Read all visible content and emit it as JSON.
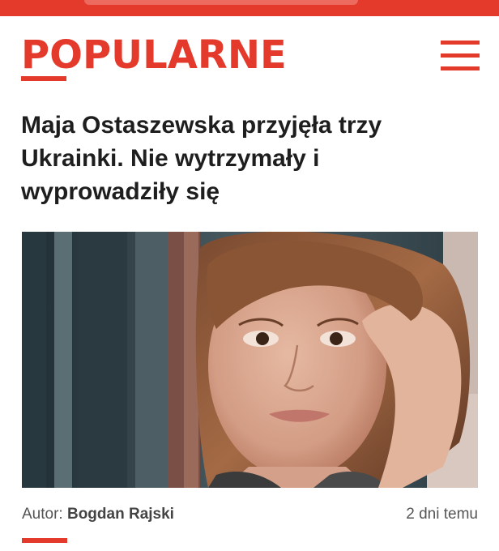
{
  "header": {
    "logo_text": "POPULARNE",
    "menu_icon": "hamburger-menu-icon"
  },
  "article": {
    "headline": "Maja Ostaszewska przyjęła trzy Ukrainki. Nie wytrzymały i wyprowadziły się",
    "author_label": "Autor:",
    "author_name": "Bogdan Rajski",
    "published": "2 dni temu"
  },
  "colors": {
    "accent": "#e33a2c",
    "headline": "#1e1e1e",
    "meta": "#555555"
  }
}
